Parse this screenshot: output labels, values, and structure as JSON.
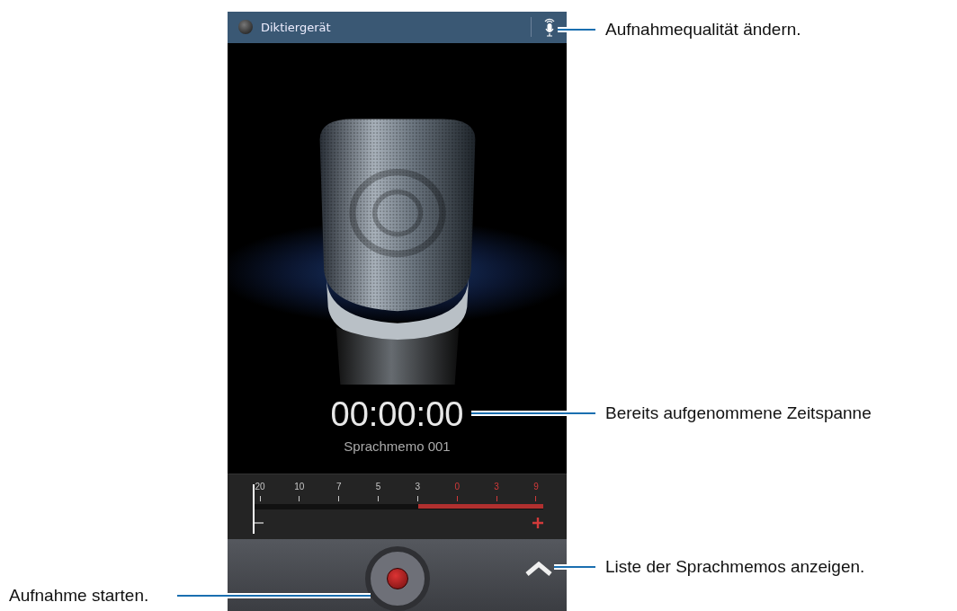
{
  "app_bar": {
    "title": "Diktiergerät"
  },
  "timer": "00:00:00",
  "file_name": "Sprachmemo 001",
  "meter": {
    "level": 0,
    "scale": [
      {
        "label": "20",
        "kind": "normal"
      },
      {
        "label": "10",
        "kind": "normal"
      },
      {
        "label": "7",
        "kind": "normal"
      },
      {
        "label": "5",
        "kind": "normal"
      },
      {
        "label": "3",
        "kind": "normal"
      },
      {
        "label": "0",
        "kind": "peak"
      },
      {
        "label": "3",
        "kind": "peak"
      },
      {
        "label": "9",
        "kind": "peak"
      }
    ]
  },
  "callouts": [
    {
      "text": "Aufnahmequalität ändern.",
      "kind": "right"
    },
    {
      "text": "Bereits aufgenommene Zeitspanne",
      "kind": "right"
    },
    {
      "text": "Aufnahme starten.",
      "kind": "left"
    },
    {
      "text": "Liste der Sprachmemos anzeigen.",
      "kind": "right"
    }
  ]
}
